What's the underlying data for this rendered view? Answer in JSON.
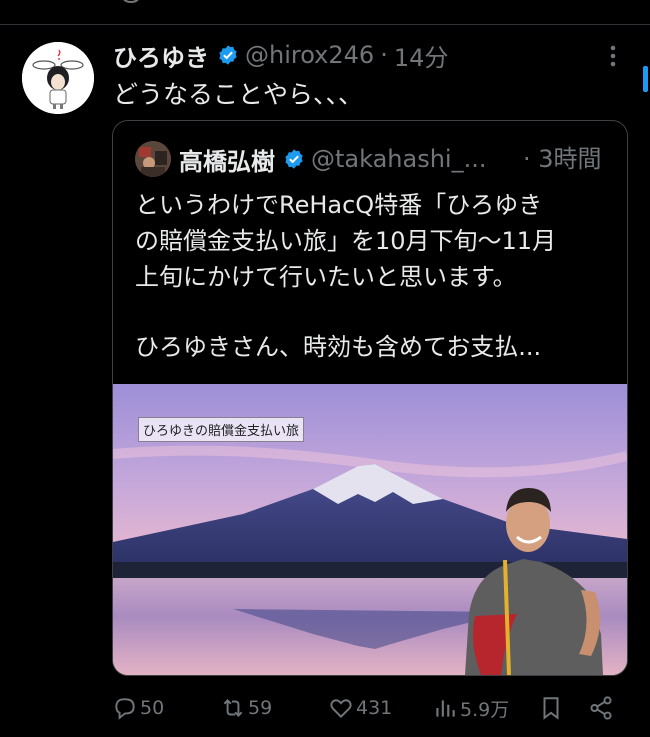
{
  "tweet": {
    "display_name": "ひろゆき",
    "handle": "@hirox246",
    "separator": "·",
    "time": "14分",
    "text": "どうなることやら、、、"
  },
  "quote": {
    "display_name": "高橋弘樹",
    "handle": "@takahashi_...",
    "separator": "·",
    "time": "3時間",
    "lines": [
      "というわけでReHacQ特番「ひろゆき",
      "の賠償金支払い旅」を10月下旬〜11月",
      "上旬にかけて行いたいと思います。",
      "",
      "ひろゆきさん、時効も含めてお支払..."
    ],
    "media_caption": "ひろゆきの賠償金支払い旅"
  },
  "actions": {
    "reply_count": "50",
    "retweet_count": "59",
    "like_count": "431",
    "views_count": "5.9万"
  },
  "colors": {
    "background": "#000000",
    "text": "#e7e9ea",
    "muted": "#71767b",
    "verified": "#1d9bf0",
    "border": "#2f3336"
  }
}
